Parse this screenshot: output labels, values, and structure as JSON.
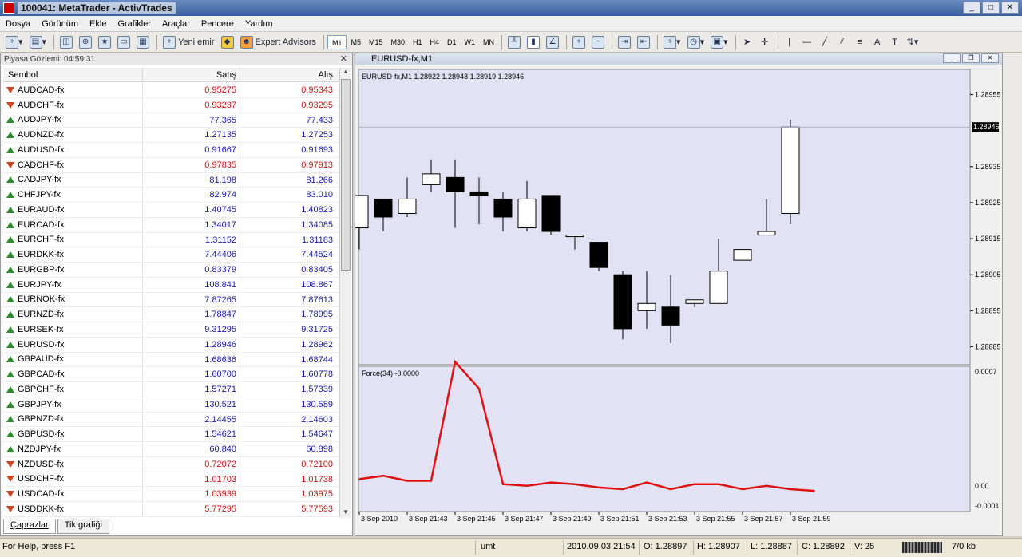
{
  "window": {
    "title": "100041: MetaTrader - ActivTrades",
    "controls": [
      "_",
      "□",
      "✕"
    ]
  },
  "menu": [
    "Dosya",
    "Görünüm",
    "Ekle",
    "Grafikler",
    "Araçlar",
    "Pencere",
    "Yardım"
  ],
  "toolbar": {
    "new_order_label": "Yeni emir",
    "expert_advisors_label": "Expert Advisors",
    "timeframes": [
      "M1",
      "M5",
      "M15",
      "M30",
      "H1",
      "H4",
      "D1",
      "W1",
      "MN"
    ],
    "active_timeframe": "M1"
  },
  "market_watch": {
    "header": "Piyasa Gözlemi: 04:59:31",
    "columns": [
      "Sembol",
      "Satış",
      "Alış"
    ],
    "rows": [
      {
        "symbol": "AUDCAD-fx",
        "bid": "0.95275",
        "ask": "0.95343",
        "dir": "down"
      },
      {
        "symbol": "AUDCHF-fx",
        "bid": "0.93237",
        "ask": "0.93295",
        "dir": "down"
      },
      {
        "symbol": "AUDJPY-fx",
        "bid": "77.365",
        "ask": "77.433",
        "dir": "up"
      },
      {
        "symbol": "AUDNZD-fx",
        "bid": "1.27135",
        "ask": "1.27253",
        "dir": "up"
      },
      {
        "symbol": "AUDUSD-fx",
        "bid": "0.91667",
        "ask": "0.91693",
        "dir": "up"
      },
      {
        "symbol": "CADCHF-fx",
        "bid": "0.97835",
        "ask": "0.97913",
        "dir": "down"
      },
      {
        "symbol": "CADJPY-fx",
        "bid": "81.198",
        "ask": "81.266",
        "dir": "up"
      },
      {
        "symbol": "CHFJPY-fx",
        "bid": "82.974",
        "ask": "83.010",
        "dir": "up"
      },
      {
        "symbol": "EURAUD-fx",
        "bid": "1.40745",
        "ask": "1.40823",
        "dir": "up"
      },
      {
        "symbol": "EURCAD-fx",
        "bid": "1.34017",
        "ask": "1.34085",
        "dir": "up"
      },
      {
        "symbol": "EURCHF-fx",
        "bid": "1.31152",
        "ask": "1.31183",
        "dir": "up"
      },
      {
        "symbol": "EURDKK-fx",
        "bid": "7.44406",
        "ask": "7.44524",
        "dir": "up"
      },
      {
        "symbol": "EURGBP-fx",
        "bid": "0.83379",
        "ask": "0.83405",
        "dir": "up"
      },
      {
        "symbol": "EURJPY-fx",
        "bid": "108.841",
        "ask": "108.867",
        "dir": "up"
      },
      {
        "symbol": "EURNOK-fx",
        "bid": "7.87265",
        "ask": "7.87613",
        "dir": "up"
      },
      {
        "symbol": "EURNZD-fx",
        "bid": "1.78847",
        "ask": "1.78995",
        "dir": "up"
      },
      {
        "symbol": "EURSEK-fx",
        "bid": "9.31295",
        "ask": "9.31725",
        "dir": "up"
      },
      {
        "symbol": "EURUSD-fx",
        "bid": "1.28946",
        "ask": "1.28962",
        "dir": "up"
      },
      {
        "symbol": "GBPAUD-fx",
        "bid": "1.68636",
        "ask": "1.68744",
        "dir": "up"
      },
      {
        "symbol": "GBPCAD-fx",
        "bid": "1.60700",
        "ask": "1.60778",
        "dir": "up"
      },
      {
        "symbol": "GBPCHF-fx",
        "bid": "1.57271",
        "ask": "1.57339",
        "dir": "up"
      },
      {
        "symbol": "GBPJPY-fx",
        "bid": "130.521",
        "ask": "130.589",
        "dir": "up"
      },
      {
        "symbol": "GBPNZD-fx",
        "bid": "2.14455",
        "ask": "2.14603",
        "dir": "up"
      },
      {
        "symbol": "GBPUSD-fx",
        "bid": "1.54621",
        "ask": "1.54647",
        "dir": "up"
      },
      {
        "symbol": "NZDJPY-fx",
        "bid": "60.840",
        "ask": "60.898",
        "dir": "up"
      },
      {
        "symbol": "NZDUSD-fx",
        "bid": "0.72072",
        "ask": "0.72100",
        "dir": "down"
      },
      {
        "symbol": "USDCHF-fx",
        "bid": "1.01703",
        "ask": "1.01738",
        "dir": "down"
      },
      {
        "symbol": "USDCAD-fx",
        "bid": "1.03939",
        "ask": "1.03975",
        "dir": "down"
      },
      {
        "symbol": "USDDKK-fx",
        "bid": "5.77295",
        "ask": "5.77593",
        "dir": "down"
      }
    ],
    "tabs": [
      "Çaprazlar",
      "Tik grafiği"
    ]
  },
  "chart_window": {
    "title": "EURUSD-fx,M1"
  },
  "chart_data": [
    {
      "type": "candlestick",
      "title": "EURUSD-fx,M1  1.28922 1.28948 1.28919 1.28946",
      "ylim": [
        1.2888,
        1.28962
      ],
      "yticks": [
        "1.28955",
        "1.28935",
        "1.28925",
        "1.28915",
        "1.28905",
        "1.28895",
        "1.28885"
      ],
      "current_price": "1.28946",
      "x_labels": [
        "3 Sep 2010",
        "3 Sep 21:43",
        "3 Sep 21:45",
        "3 Sep 21:47",
        "3 Sep 21:49",
        "3 Sep 21:51",
        "3 Sep 21:53",
        "3 Sep 21:55",
        "3 Sep 21:57",
        "3 Sep 21:59"
      ],
      "candles": [
        {
          "o": 1.28918,
          "h": 1.28926,
          "l": 1.28912,
          "c": 1.28927
        },
        {
          "o": 1.28926,
          "h": 1.28926,
          "l": 1.28917,
          "c": 1.28921
        },
        {
          "o": 1.28922,
          "h": 1.28932,
          "l": 1.28921,
          "c": 1.28926
        },
        {
          "o": 1.2893,
          "h": 1.28937,
          "l": 1.28928,
          "c": 1.28933
        },
        {
          "o": 1.28932,
          "h": 1.28937,
          "l": 1.28918,
          "c": 1.28928
        },
        {
          "o": 1.28928,
          "h": 1.28932,
          "l": 1.28919,
          "c": 1.28927
        },
        {
          "o": 1.28926,
          "h": 1.28928,
          "l": 1.28917,
          "c": 1.28921
        },
        {
          "o": 1.28918,
          "h": 1.28931,
          "l": 1.28917,
          "c": 1.28926
        },
        {
          "o": 1.28927,
          "h": 1.28927,
          "l": 1.28916,
          "c": 1.28917
        },
        {
          "o": 1.28916,
          "h": 1.28916,
          "l": 1.28912,
          "c": 1.28916
        },
        {
          "o": 1.28914,
          "h": 1.28914,
          "l": 1.28906,
          "c": 1.28907
        },
        {
          "o": 1.28905,
          "h": 1.28906,
          "l": 1.28887,
          "c": 1.2889
        },
        {
          "o": 1.28895,
          "h": 1.28906,
          "l": 1.2889,
          "c": 1.28897
        },
        {
          "o": 1.28896,
          "h": 1.28905,
          "l": 1.28886,
          "c": 1.28891
        },
        {
          "o": 1.28897,
          "h": 1.28898,
          "l": 1.28896,
          "c": 1.28898
        },
        {
          "o": 1.28897,
          "h": 1.28915,
          "l": 1.28897,
          "c": 1.28906
        },
        {
          "o": 1.28909,
          "h": 1.28911,
          "l": 1.28909,
          "c": 1.28912
        },
        {
          "o": 1.28916,
          "h": 1.28926,
          "l": 1.28916,
          "c": 1.28917
        },
        {
          "o": 1.28922,
          "h": 1.28948,
          "l": 1.28919,
          "c": 1.28946
        }
      ]
    },
    {
      "type": "line",
      "title": "Force(34) -0.0000",
      "ylim": [
        -0.0001,
        0.0007
      ],
      "yticks": [
        "0.0007",
        "0.00",
        "-0.0001"
      ],
      "series": [
        {
          "values": [
            6e-05,
            8e-05,
            5e-05,
            5e-05,
            0.00076,
            0.0006,
            3e-05,
            2e-05,
            4e-05,
            3e-05,
            1e-05,
            -0.0,
            4e-05,
            0.0,
            3e-05,
            3e-05,
            0.0,
            2e-05,
            0.0,
            -1e-05
          ]
        }
      ],
      "line_color": "#dd1111"
    }
  ],
  "statusbar": {
    "help": "For Help, press F1",
    "profile": "umt",
    "datetime": "2010.09.03 21:54",
    "open": "O: 1.28897",
    "high": "H: 1.28907",
    "low": "L: 1.28887",
    "close": "C: 1.28892",
    "volume": "V: 25",
    "traffic": "7/0 kb"
  },
  "colors": {
    "chart_bg": "#e2e2f4",
    "bull": "#ffffff",
    "bear": "#000000",
    "indicator": "#dd1111"
  }
}
